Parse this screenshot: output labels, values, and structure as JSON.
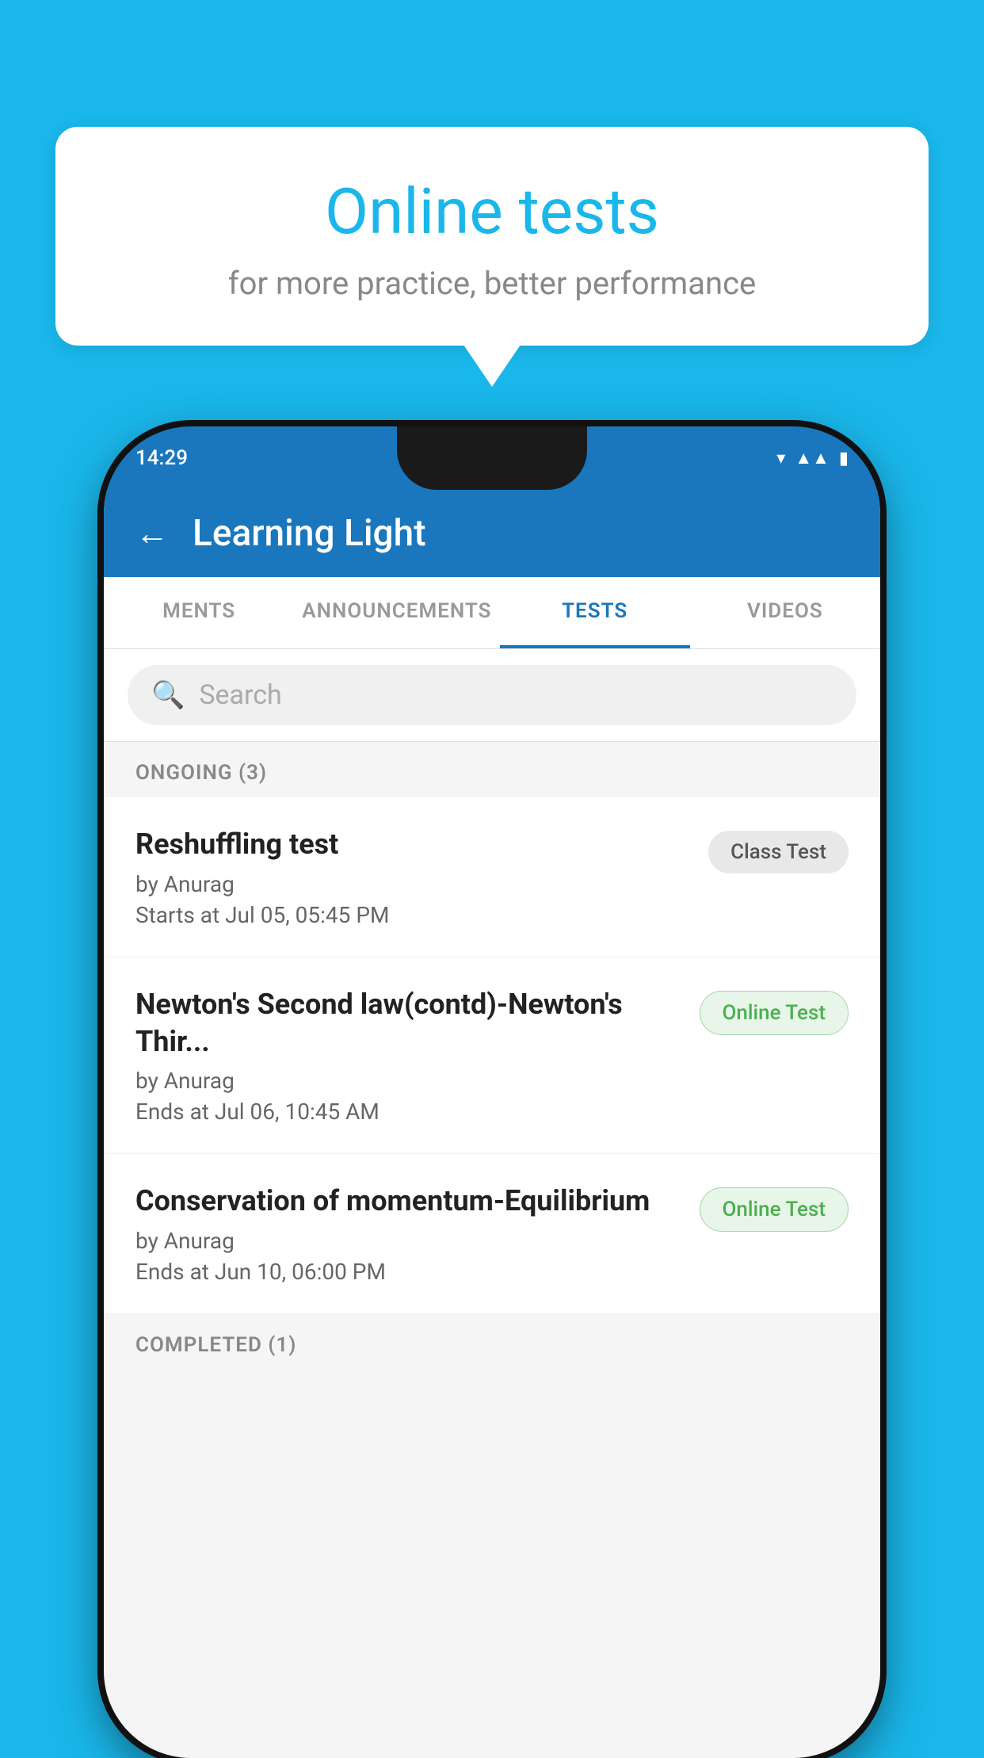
{
  "background_color": "#1ab7ea",
  "speech_bubble": {
    "title": "Online tests",
    "subtitle": "for more practice, better performance"
  },
  "phone": {
    "status_bar": {
      "time": "14:29",
      "icons": [
        "wifi",
        "signal",
        "battery"
      ]
    },
    "app_header": {
      "back_label": "←",
      "title": "Learning Light"
    },
    "tabs": [
      {
        "label": "MENTS",
        "active": false
      },
      {
        "label": "ANNOUNCEMENTS",
        "active": false
      },
      {
        "label": "TESTS",
        "active": true
      },
      {
        "label": "VIDEOS",
        "active": false
      }
    ],
    "search": {
      "placeholder": "Search"
    },
    "ongoing_section": {
      "label": "ONGOING (3)",
      "tests": [
        {
          "name": "Reshuffling test",
          "by": "by Anurag",
          "time": "Starts at  Jul 05, 05:45 PM",
          "badge": "Class Test",
          "badge_type": "class"
        },
        {
          "name": "Newton's Second law(contd)-Newton's Thir...",
          "by": "by Anurag",
          "time": "Ends at  Jul 06, 10:45 AM",
          "badge": "Online Test",
          "badge_type": "online"
        },
        {
          "name": "Conservation of momentum-Equilibrium",
          "by": "by Anurag",
          "time": "Ends at  Jun 10, 06:00 PM",
          "badge": "Online Test",
          "badge_type": "online"
        }
      ]
    },
    "completed_section": {
      "label": "COMPLETED (1)"
    }
  }
}
